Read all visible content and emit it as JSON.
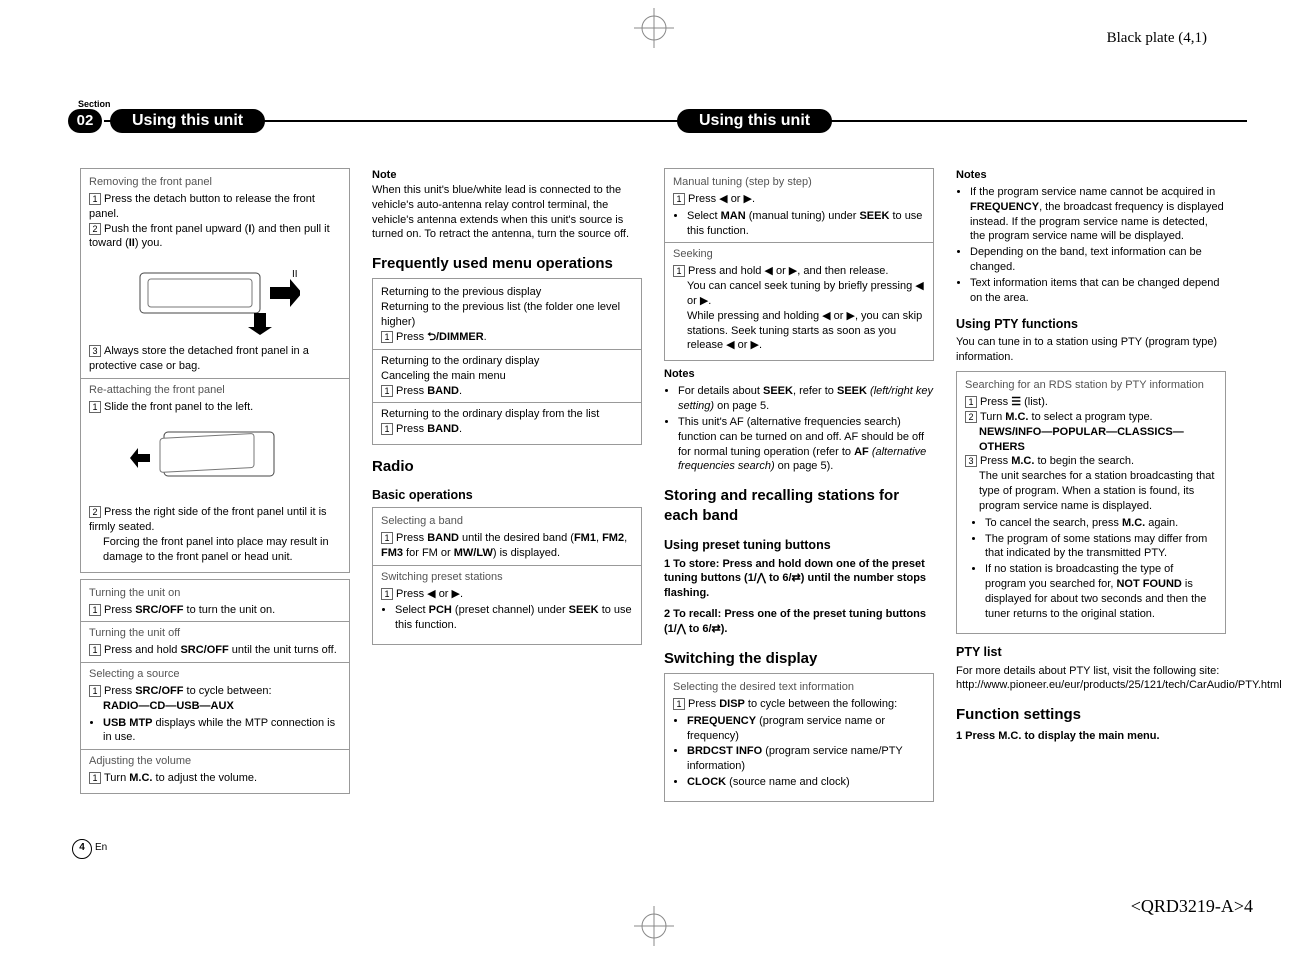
{
  "blackplate": "Black plate (4,1)",
  "section_label": "Section",
  "section_num": "02",
  "title_left": "Using this unit",
  "title_right": "Using this unit",
  "col1": {
    "box1": {
      "head": "Removing the front panel",
      "s1": "Press the detach button to release the front panel.",
      "s2_a": "Push the front panel upward (",
      "s2_b": ") and then pull it toward (",
      "s2_c": ") you.",
      "s3": "Always store the detached front panel in a protective case or bag.",
      "head2": "Re-attaching the front panel",
      "s4": "Slide the front panel to the left.",
      "s5": "Press the right side of the front panel until it is firmly seated.",
      "s5b": "Forcing the front panel into place may result in damage to the front panel or head unit."
    },
    "box2": {
      "head": "Turning the unit on",
      "s1a": "Press ",
      "s1b": "SRC/OFF",
      "s1c": " to turn the unit on."
    },
    "box3": {
      "head": "Turning the unit off",
      "s1a": "Press and hold ",
      "s1b": "SRC/OFF",
      "s1c": " until the unit turns off."
    },
    "box4": {
      "head": "Selecting a source",
      "s1a": "Press ",
      "s1b": "SRC/OFF",
      "s1c": " to cycle between:",
      "chain": "RADIO—CD—USB—AUX",
      "bul_a": "USB MTP",
      "bul_b": " displays while the MTP connection is in use."
    },
    "box5": {
      "head": "Adjusting the volume",
      "s1a": "Turn ",
      "s1b": "M.C.",
      "s1c": " to adjust the volume."
    }
  },
  "col2": {
    "note_h": "Note",
    "note_t": "When this unit's blue/white lead is connected to the vehicle's auto-antenna relay control terminal, the vehicle's antenna extends when this unit's source is turned on. To retract the antenna, turn the source off.",
    "h3": "Frequently used menu operations",
    "boxA": {
      "l1": "Returning to the previous display",
      "l2": "Returning to the previous list (the folder one level higher)",
      "s1a": "Press ",
      "s1b": "/DIMMER",
      "s1c": ".",
      "l3": "Returning to the ordinary display",
      "l4": "Canceling the main menu",
      "s2a": "Press ",
      "s2b": "BAND",
      "s2c": ".",
      "l5": "Returning to the ordinary display from the list",
      "s3a": "Press ",
      "s3b": "BAND",
      "s3c": "."
    },
    "h3b": "Radio",
    "h4": "Basic operations",
    "boxB": {
      "head": "Selecting a band",
      "s1a": "Press ",
      "s1b": "BAND",
      "s1c": " until the desired band (",
      "s1d": "FM1",
      "s1e": ", ",
      "s1f": "FM2",
      "s1g": ", ",
      "s1h": "FM3",
      "s1i": " for FM or ",
      "s1j": "MW/LW",
      "s1k": ") is displayed.",
      "head2": "Switching preset stations",
      "s2": "Press ◀ or ▶.",
      "bul_a": "Select ",
      "bul_b": "PCH",
      "bul_c": " (preset channel) under ",
      "bul_d": "SEEK",
      "bul_e": " to use this function."
    }
  },
  "col3": {
    "boxA": {
      "head": "Manual tuning (step by step)",
      "s1": "Press ◀ or ▶.",
      "bul_a": "Select ",
      "bul_b": "MAN",
      "bul_c": " (manual tuning) under ",
      "bul_d": "SEEK",
      "bul_e": " to use this function.",
      "head2": "Seeking",
      "s2": "Press and hold ◀ or ▶, and then release.",
      "s2b": "You can cancel seek tuning by briefly pressing ◀ or ▶.",
      "s2c": "While pressing and holding ◀ or ▶, you can skip stations. Seek tuning starts as soon as you release ◀ or ▶."
    },
    "notes_h": "Notes",
    "notes_b1a": "For details about ",
    "notes_b1b": "SEEK",
    "notes_b1c": ", refer to ",
    "notes_b1d": "SEEK",
    "notes_b1e": " (left/right key setting)",
    "notes_b1f": " on page 5.",
    "notes_b2a": "This unit's AF (alternative frequencies search) function can be turned on and off. AF should be off for normal tuning operation (refer to ",
    "notes_b2b": "AF",
    "notes_b2c": " (alternative frequencies search)",
    "notes_b2d": " on page 5).",
    "h3": "Storing and recalling stations for each band",
    "h4": "Using preset tuning buttons",
    "p1": "1   To store: Press and hold down one of the preset tuning buttons (1/⋀ to 6/⇄) until the number stops flashing.",
    "p2": "2   To recall: Press one of the preset tuning buttons (1/⋀ to 6/⇄).",
    "h3b": "Switching the display",
    "boxB": {
      "head": "Selecting the desired text information",
      "s1a": "Press ",
      "s1b": "DISP",
      "s1c": " to cycle between the following:",
      "b1a": "FREQUENCY",
      "b1b": " (program service name or frequency)",
      "b2a": "BRDCST INFO",
      "b2b": " (program service name/PTY information)",
      "b3a": "CLOCK",
      "b3b": " (source name and clock)"
    }
  },
  "col4": {
    "notes_h": "Notes",
    "n1a": "If the program service name cannot be acquired in ",
    "n1b": "FREQUENCY",
    "n1c": ", the broadcast frequency is displayed instead. If the program service name is detected, the program service name will be displayed.",
    "n2": "Depending on the band, text information can be changed.",
    "n3": "Text information items that can be changed depend on the area.",
    "h4": "Using PTY functions",
    "pty_intro": "You can tune in to a station using PTY (program type) information.",
    "boxA": {
      "head": "Searching for an RDS station by PTY information",
      "s1a": "Press ",
      "s1b": " (list).",
      "s2a": "Turn ",
      "s2b": "M.C.",
      "s2c": " to select a program type.",
      "chain": "NEWS/INFO—POPULAR—CLASSICS—OTHERS",
      "s3a": "Press ",
      "s3b": "M.C.",
      "s3c": " to begin the search.",
      "s3d": "The unit searches for a station broadcasting that type of program. When a station is found, its program service name is displayed.",
      "b1a": "To cancel the search, press ",
      "b1b": "M.C.",
      "b1c": " again.",
      "b2": "The program of some stations may differ from that indicated by the transmitted PTY.",
      "b3a": "If no station is broadcasting the type of program you searched for, ",
      "b3b": "NOT FOUND",
      "b3c": " is displayed for about two seconds and then the tuner returns to the original station."
    },
    "h4b": "PTY list",
    "pty_more": "For more details about PTY list, visit the following site:",
    "pty_url": "http://www.pioneer.eu/eur/products/25/121/tech/CarAudio/PTY.html",
    "h3": "Function settings",
    "fs_1": "1   Press M.C. to display the main menu."
  },
  "page_num": "4",
  "page_lang": "En",
  "footer_code": "<QRD3219-A>4"
}
